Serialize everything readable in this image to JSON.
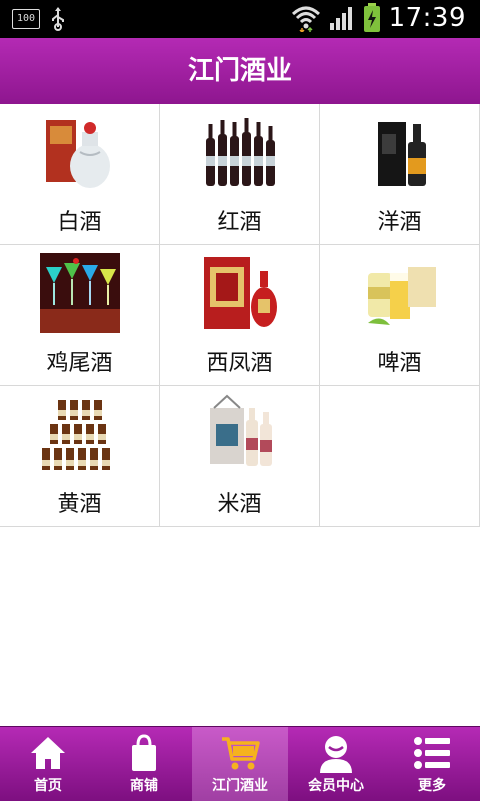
{
  "status": {
    "battery_label": "100",
    "time": "17:39"
  },
  "header": {
    "title": "江门酒业"
  },
  "categories": [
    {
      "label": "白酒",
      "icon": "baijiu-product-image"
    },
    {
      "label": "红酒",
      "icon": "red-wine-product-image"
    },
    {
      "label": "洋酒",
      "icon": "whisky-product-image"
    },
    {
      "label": "鸡尾酒",
      "icon": "cocktail-product-image"
    },
    {
      "label": "西凤酒",
      "icon": "xifeng-product-image"
    },
    {
      "label": "啤酒",
      "icon": "beer-product-image"
    },
    {
      "label": "黄酒",
      "icon": "huangjiu-product-image"
    },
    {
      "label": "米酒",
      "icon": "rice-wine-product-image"
    }
  ],
  "nav": {
    "items": [
      {
        "label": "首页",
        "icon": "home-icon"
      },
      {
        "label": "商铺",
        "icon": "shopping-bag-icon"
      },
      {
        "label": "江门酒业",
        "icon": "cart-icon",
        "active": true
      },
      {
        "label": "会员中心",
        "icon": "user-icon"
      },
      {
        "label": "更多",
        "icon": "list-icon"
      }
    ]
  },
  "colors": {
    "header": "#9e1f9f",
    "nav": "#9a1e9b",
    "active_tab": "#b44db6"
  }
}
